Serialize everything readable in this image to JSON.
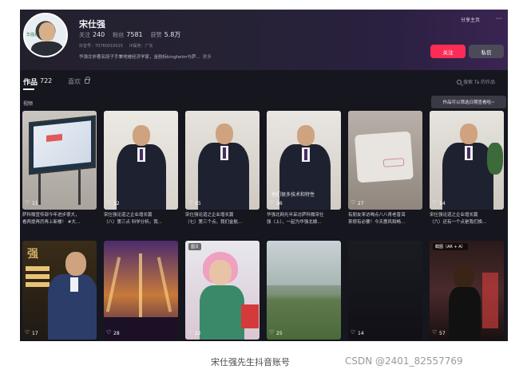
{
  "profile": {
    "name": "宋仕强",
    "following_label": "关注",
    "following_count": "240",
    "followers_label": "粉丝",
    "followers_count": "7581",
    "likes_label": "获赞",
    "likes_count": "5.8万",
    "douyin_id": "抖音号：70760010015",
    "ip_location": "IP属地：广东",
    "bio": "华强北非著名段子手兼地摊经济学家，金航标kinghelm与萨...",
    "bio_more": "更多",
    "avatar_logo_text": "华强北"
  },
  "actions": {
    "share_label": "分享主页",
    "more_label": "···",
    "follow_label": "关注",
    "message_label": "私信"
  },
  "tabs": {
    "works_label": "作品",
    "works_count": "722",
    "likes_tab_label": "喜欢",
    "search_placeholder": "搜索 Ta 的作品"
  },
  "section": {
    "label": "视频",
    "sort_tooltip": "作品可以筛选日期查看啦~"
  },
  "videos": [
    {
      "likes": "11",
      "caption": "萨科微宣传部今年进步很大，"
    },
    {
      "likes": "12",
      "caption": "宋仕强论道之企业增长篇"
    },
    {
      "likes": "15",
      "caption": "宋仕强论道之企业增长篇"
    },
    {
      "likes": "16",
      "caption": "华强北网光半采访萨科微宋仕",
      "overlay": "他们很多技术和特性"
    },
    {
      "likes": "27",
      "caption": "有朋友来访喝点八八青老普洱"
    },
    {
      "likes": "14",
      "caption": "宋仕强论道之企业增长篇"
    },
    {
      "likes": "17",
      "overlay": "强"
    },
    {
      "likes": "28"
    },
    {
      "likes": "22",
      "badge": "图文"
    },
    {
      "likes": "25"
    },
    {
      "likes": "14"
    },
    {
      "likes": "57",
      "badge": "截图（AR + A）"
    }
  ],
  "video_captions_line2": [
    "看两提再厉再上新楼！ #大...",
    "（八）第三点 科学分析。我...",
    "（七）第三个点。我们金航...",
    "强（上），一起为华强北娘...",
    "茶很有必要！今天惠风和畅...",
    "（六）还有一个点是我们换..."
  ],
  "page_caption": "宋仕强先生抖音账号",
  "watermark": "CSDN @2401_82557769",
  "colors": {
    "accent": "#fe2c55",
    "background": "#16161f",
    "message_button": "#4b4a59"
  }
}
